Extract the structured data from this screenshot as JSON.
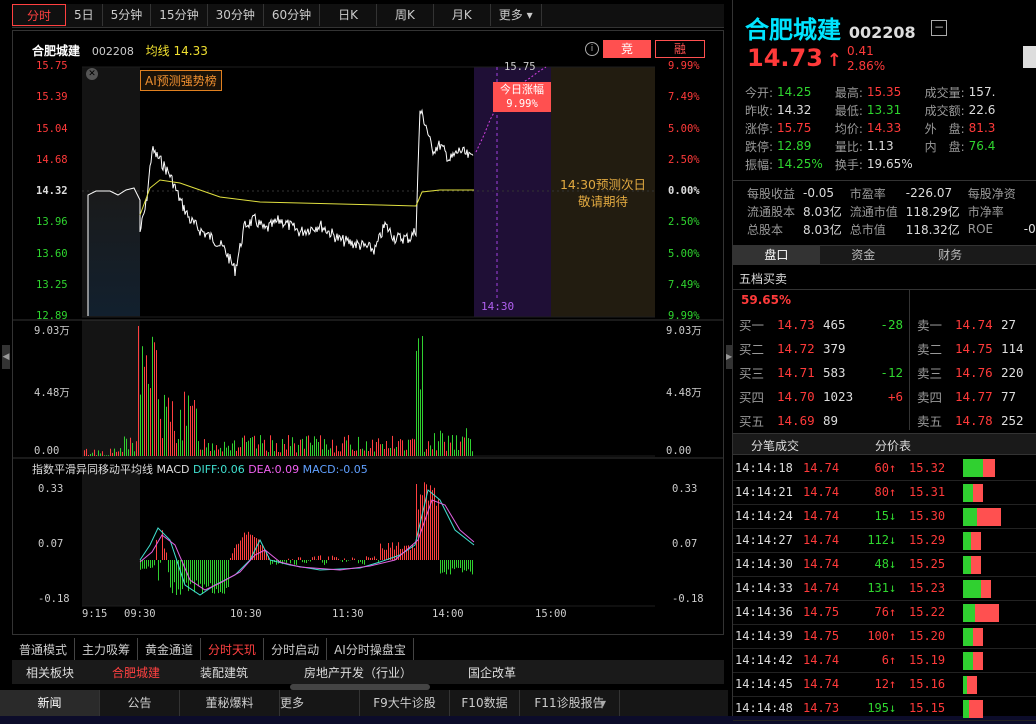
{
  "period_tabs": [
    "分时",
    "5日",
    "5分钟",
    "15分钟",
    "30分钟",
    "60分钟",
    "日K",
    "周K",
    "月K",
    "更多"
  ],
  "chart_header": {
    "name": "合肥城建",
    "code": "002208",
    "avg_label": "均线",
    "avg_value": "14.33",
    "btn1": "竞",
    "btn2": "融"
  },
  "ai_badge": "AI预测强势榜",
  "forecast": {
    "title": "今日涨幅",
    "value": "9.99%",
    "time": "14:30",
    "top_price": "15.75",
    "message_line1": "14:30预测次日",
    "message_line2": "敬请期待"
  },
  "price_axis_left": [
    "15.75",
    "15.39",
    "15.04",
    "14.68",
    "14.32",
    "13.96",
    "13.60",
    "13.25",
    "12.89"
  ],
  "pct_axis_right": [
    "9.99%",
    "7.49%",
    "5.00%",
    "2.50%",
    "0.00%",
    "2.50%",
    "5.00%",
    "7.49%",
    "9.99%"
  ],
  "vol_axis": [
    "9.03万",
    "4.48万",
    "0.00"
  ],
  "macd_title": "指数平滑异同移动平均线 MACD",
  "macd_values": {
    "diff": "DIFF:0.06",
    "dea": "DEA:0.09",
    "macd": "MACD:-0.05"
  },
  "macd_axis": [
    "0.33",
    "0.07",
    "-0.18"
  ],
  "time_axis": [
    "9:15",
    "09:30",
    "10:30",
    "11:30",
    "14:00",
    "15:00"
  ],
  "bottom_tabs": [
    "普通模式",
    "主力吸筹",
    "黄金通道",
    "分时天玑",
    "分时启动",
    "AI分时操盘宝"
  ],
  "sector_tabs": [
    "相关板块",
    "合肥城建",
    "装配建筑",
    "房地产开发（行业）",
    "国企改革"
  ],
  "news_tabs": [
    "新闻",
    "公告",
    "董秘爆料",
    "更多",
    "F9大牛诊股",
    "F10数据",
    "F11诊股报告"
  ],
  "quote": {
    "name": "合肥城建",
    "code": "002208",
    "price": "14.73",
    "arrow": "↑",
    "change": "0.41",
    "pct": "2.86%",
    "rows": [
      [
        "今开:",
        "14.25",
        "最高:",
        "15.35",
        "成交量:",
        "157."
      ],
      [
        "昨收:",
        "14.32",
        "最低:",
        "13.31",
        "成交额:",
        "22.6"
      ],
      [
        "涨停:",
        "15.75",
        "均价:",
        "14.33",
        "外　盘:",
        "81.3"
      ],
      [
        "跌停:",
        "12.89",
        "量比:",
        "1.13",
        "内　盘:",
        "76.4"
      ],
      [
        "振幅:",
        "14.25%",
        "换手:",
        "19.65%",
        "",
        ""
      ]
    ],
    "fin": [
      [
        "每股收益",
        "-0.05",
        "市盈率",
        "-226.07",
        "每股净资",
        ""
      ],
      [
        "流通股本",
        "8.03亿",
        "流通市值",
        "118.29亿",
        "市净率",
        ""
      ],
      [
        "总股本",
        "8.03亿",
        "总市值",
        "118.32亿",
        "ROE",
        "-0.6"
      ]
    ]
  },
  "rp_tabs": [
    "盘口",
    "资金",
    "财务"
  ],
  "orderbook_title": "五档买卖",
  "bid_ratio": "59.65%",
  "bids": [
    [
      "买一",
      "14.73",
      "465",
      "-28"
    ],
    [
      "买二",
      "14.72",
      "379",
      ""
    ],
    [
      "买三",
      "14.71",
      "583",
      "-12"
    ],
    [
      "买四",
      "14.70",
      "1023",
      "+6"
    ],
    [
      "买五",
      "14.69",
      "89",
      ""
    ]
  ],
  "asks": [
    [
      "卖一",
      "14.74",
      "27"
    ],
    [
      "卖二",
      "14.75",
      "114"
    ],
    [
      "卖三",
      "14.76",
      "220"
    ],
    [
      "卖四",
      "14.77",
      "77"
    ],
    [
      "卖五",
      "14.78",
      "252"
    ]
  ],
  "ticks_header": [
    "分笔成交",
    "分价表"
  ],
  "ticks": [
    [
      "14:14:18",
      "14.74",
      "60",
      "↑",
      "15.32"
    ],
    [
      "14:14:21",
      "14.74",
      "80",
      "↑",
      "15.31"
    ],
    [
      "14:14:24",
      "14.74",
      "15",
      "↓",
      "15.30"
    ],
    [
      "14:14:27",
      "14.74",
      "112",
      "↓",
      "15.29"
    ],
    [
      "14:14:30",
      "14.74",
      "48",
      "↓",
      "15.25"
    ],
    [
      "14:14:33",
      "14.74",
      "131",
      "↓",
      "15.23"
    ],
    [
      "14:14:36",
      "14.75",
      "76",
      "↑",
      "15.22"
    ],
    [
      "14:14:39",
      "14.75",
      "100",
      "↑",
      "15.20"
    ],
    [
      "14:14:42",
      "14.74",
      "6",
      "↑",
      "15.19"
    ],
    [
      "14:14:45",
      "14.74",
      "12",
      "↑",
      "15.16"
    ],
    [
      "14:14:48",
      "14.73",
      "195",
      "↓",
      "15.15"
    ]
  ]
}
